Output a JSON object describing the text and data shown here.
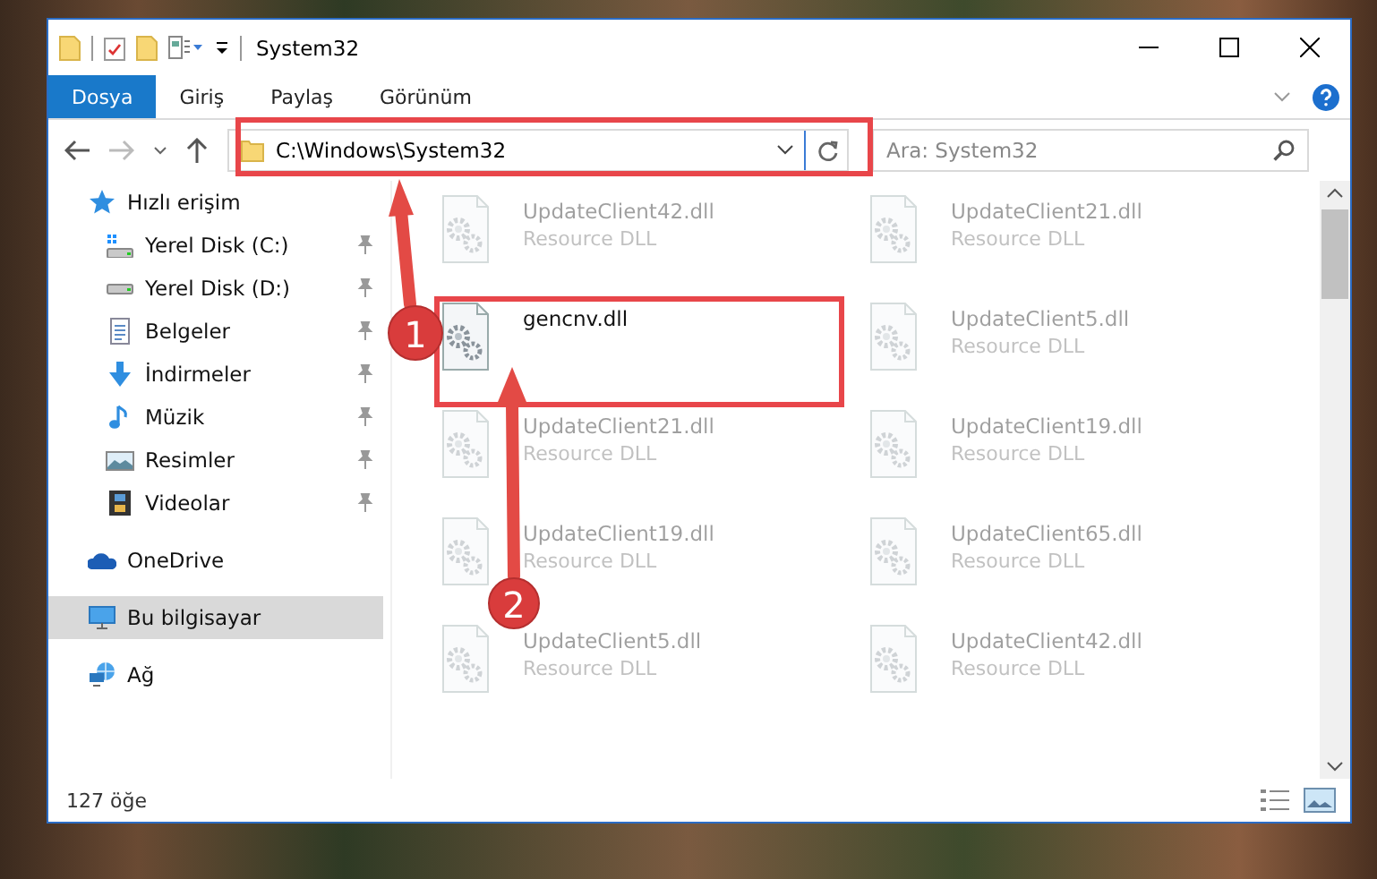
{
  "window": {
    "title": "System32"
  },
  "ribbon": {
    "tabs": [
      {
        "label": "Dosya",
        "selected": true
      },
      {
        "label": "Giriş",
        "selected": false
      },
      {
        "label": "Paylaş",
        "selected": false
      },
      {
        "label": "Görünüm",
        "selected": false
      }
    ]
  },
  "address_bar": {
    "path": "C:\\Windows\\System32"
  },
  "search": {
    "placeholder": "Ara: System32"
  },
  "navigation": {
    "items": [
      {
        "label": "Hızlı erişim",
        "kind": "star",
        "selected": false,
        "children": [
          {
            "label": "Yerel Disk (C:)",
            "kind": "drive-c",
            "selected": false,
            "pinned": true
          },
          {
            "label": "Yerel Disk (D:)",
            "kind": "drive",
            "selected": false,
            "pinned": true
          },
          {
            "label": "Belgeler",
            "kind": "document",
            "selected": false,
            "pinned": true
          },
          {
            "label": "İndirmeler",
            "kind": "download",
            "selected": false,
            "pinned": true
          },
          {
            "label": "Müzik",
            "kind": "music",
            "selected": false,
            "pinned": true
          },
          {
            "label": "Resimler",
            "kind": "picture",
            "selected": false,
            "pinned": true
          },
          {
            "label": "Videolar",
            "kind": "video",
            "selected": false,
            "pinned": true
          }
        ]
      },
      {
        "label": "OneDrive",
        "kind": "cloud",
        "selected": false
      },
      {
        "label": "Bu bilgisayar",
        "kind": "computer",
        "selected": true
      },
      {
        "label": "Ağ",
        "kind": "network",
        "selected": false
      }
    ]
  },
  "files": [
    {
      "name": "UpdateClient42.dll",
      "type": "Resource DLL",
      "dimmed": true
    },
    {
      "name": "UpdateClient21.dll",
      "type": "Resource DLL",
      "dimmed": true
    },
    {
      "name": "gencnv.dll",
      "dimmed": false
    },
    {
      "name": "UpdateClient5.dll",
      "type": "Resource DLL",
      "dimmed": true
    },
    {
      "name": "UpdateClient21.dll",
      "type": "Resource DLL",
      "dimmed": true
    },
    {
      "name": "UpdateClient19.dll",
      "type": "Resource DLL",
      "dimmed": true
    },
    {
      "name": "UpdateClient19.dll",
      "type": "Resource DLL",
      "dimmed": true
    },
    {
      "name": "UpdateClient65.dll",
      "type": "Resource DLL",
      "dimmed": true
    },
    {
      "name": "UpdateClient5.dll",
      "type": "Resource DLL",
      "dimmed": true
    },
    {
      "name": "UpdateClient42.dll",
      "type": "Resource DLL",
      "dimmed": true
    }
  ],
  "status_bar": {
    "item_count": "127 öğe"
  },
  "annotations": [
    {
      "number": "1"
    },
    {
      "number": "2"
    }
  ]
}
